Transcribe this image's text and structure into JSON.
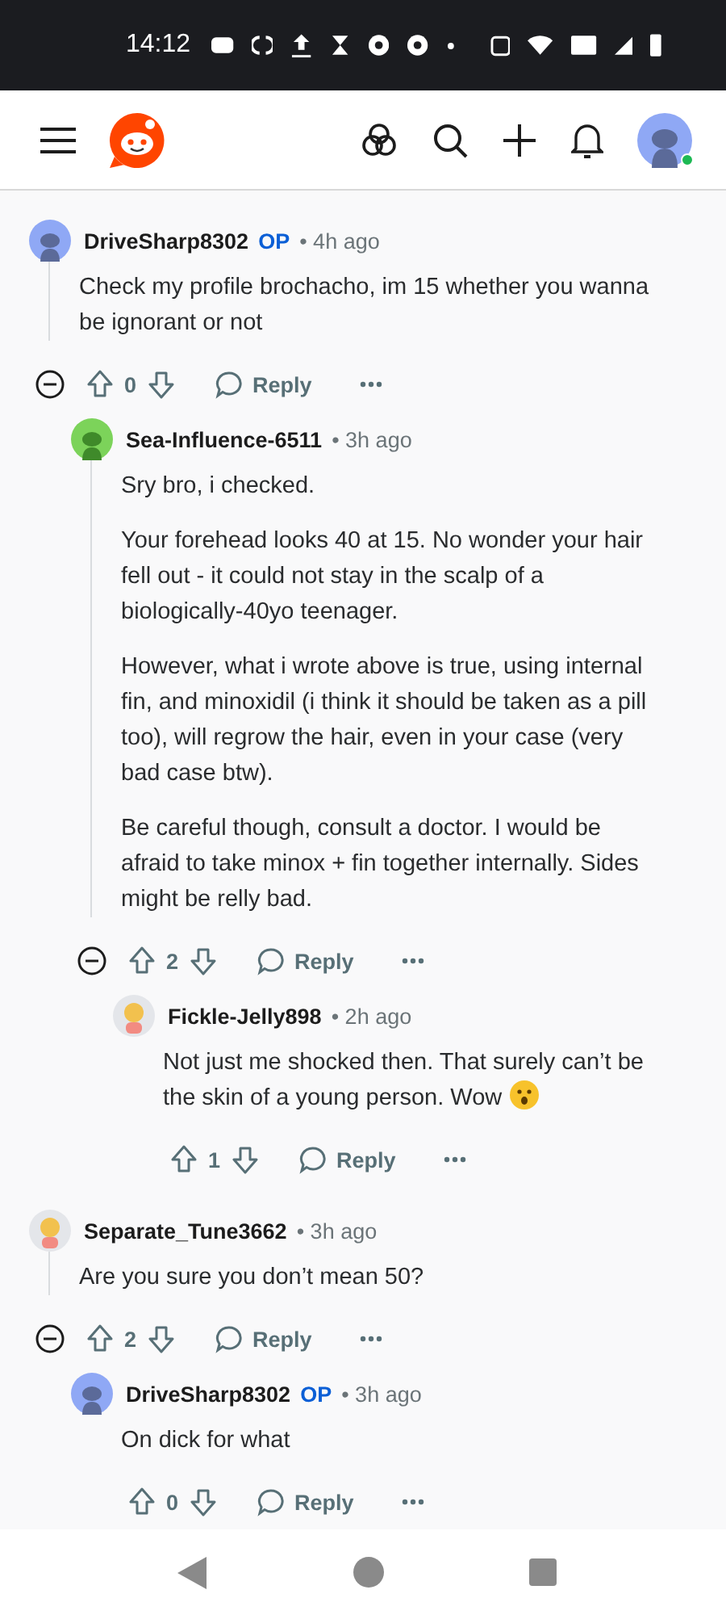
{
  "status_bar": {
    "time": "14:12"
  },
  "comments": [
    {
      "author": "DriveSharp8302",
      "op": true,
      "op_label": "OP",
      "time": "• 4h ago",
      "avatar": {
        "kind": "default"
      },
      "body": [
        "Check my profile brochacho, im 15 whether you wanna be ignorant or not"
      ],
      "votes": "0",
      "reply": "Reply",
      "collapsible": true,
      "children": [
        {
          "author": "Sea-Influence-6511",
          "op": false,
          "time": "• 3h ago",
          "avatar": {
            "kind": "green"
          },
          "body": [
            "Sry bro, i checked.",
            "Your forehead looks 40 at 15. No wonder your hair fell out - it could not stay in the scalp of a biologically-40yo teenager.",
            "However, what i wrote above is true, using internal fin, and minoxidil (i think it should be taken as a pill too), will regrow the hair, even in your case (very bad case btw).",
            "Be careful though, consult a doctor. I would be afraid to take minox + fin together internally. Sides might be relly bad."
          ],
          "votes": "2",
          "reply": "Reply",
          "collapsible": true,
          "children": [
            {
              "author": "Fickle-Jelly898",
              "op": false,
              "time": "• 2h ago",
              "avatar": {
                "kind": "custom"
              },
              "body": [
                "Not just me shocked then. That surely can’t be the skin of a young person. Wow"
              ],
              "emoji": {
                "kind": "surprised"
              },
              "votes": "1",
              "reply": "Reply",
              "collapsible": false
            }
          ]
        }
      ]
    },
    {
      "author": "Separate_Tune3662",
      "op": false,
      "time": "• 3h ago",
      "avatar": {
        "kind": "custom"
      },
      "body": [
        "Are you sure you don’t mean 50?"
      ],
      "votes": "2",
      "reply": "Reply",
      "collapsible": true,
      "children": [
        {
          "author": "DriveSharp8302",
          "op": true,
          "op_label": "OP",
          "time": "• 3h ago",
          "avatar": {
            "kind": "default"
          },
          "body": [
            "On dick for what"
          ],
          "votes": "0",
          "reply": "Reply",
          "collapsible": false
        }
      ]
    }
  ]
}
